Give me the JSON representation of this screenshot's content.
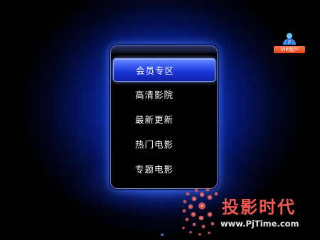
{
  "menu": {
    "items": [
      {
        "label": "会员专区",
        "selected": true
      },
      {
        "label": "高清影院",
        "selected": false
      },
      {
        "label": "最新更新",
        "selected": false
      },
      {
        "label": "热门电影",
        "selected": false
      },
      {
        "label": "专题电影",
        "selected": false
      }
    ]
  },
  "vip_badge": {
    "label": "VIP用户",
    "icon_letter": "P",
    "icon": "user-icon"
  },
  "watermark": {
    "text": "投影时代",
    "url": "www.PjTime.com"
  },
  "colors": {
    "background_glow": "#1a46e6",
    "selection": "#2e4ef0",
    "watermark_red": "#f25a52",
    "badge_orange": "#e8401c"
  }
}
